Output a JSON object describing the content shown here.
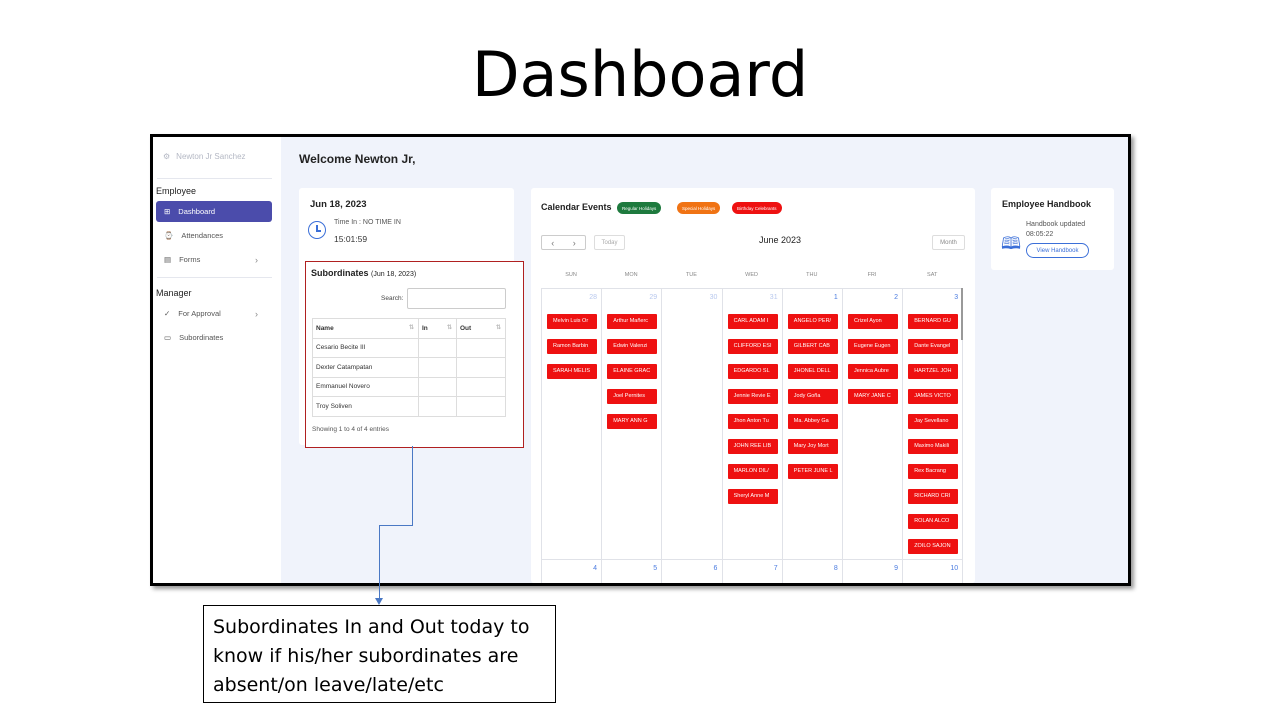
{
  "slide": {
    "title": "Dashboard",
    "callout": "Subordinates In and Out today to know if his/her subordinates are absent/on leave/late/etc"
  },
  "sidebar": {
    "user_name": "Newton Jr Sanchez",
    "sections": [
      {
        "label": "Employee"
      },
      {
        "label": "Manager"
      }
    ],
    "items": [
      {
        "label": "Dashboard",
        "icon": "grid-icon",
        "active": true
      },
      {
        "label": "Attendances",
        "icon": "watch-icon"
      },
      {
        "label": "Forms",
        "icon": "form-icon"
      },
      {
        "label": "For Approval",
        "icon": "check-icon"
      },
      {
        "label": "Subordinates",
        "icon": "monitor-icon"
      }
    ]
  },
  "header": {
    "welcome": "Welcome Newton Jr,"
  },
  "time_card": {
    "date": "Jun 18, 2023",
    "time_in_label": "Time In : NO TIME IN",
    "current_time": "15:01:59"
  },
  "subordinates": {
    "title": "Subordinates",
    "date": "(Jun 18, 2023)",
    "search_label": "Search:",
    "search_value": "",
    "columns": [
      "Name",
      "In",
      "Out"
    ],
    "rows": [
      {
        "name": "Cesario Becite III",
        "in": "",
        "out": ""
      },
      {
        "name": "Dexter Catampatan",
        "in": "",
        "out": ""
      },
      {
        "name": "Emmanuel Novero",
        "in": "",
        "out": ""
      },
      {
        "name": "Troy Soliven",
        "in": "",
        "out": ""
      }
    ],
    "footer": "Showing 1 to 4 of 4 entries"
  },
  "calendar": {
    "title": "Calendar Events",
    "legend": [
      {
        "label": "Regular Holidays",
        "color": "#1e7a3e"
      },
      {
        "label": "Special Holidays",
        "color": "#f07314"
      },
      {
        "label": "Birthday Celebrants",
        "color": "#ee1111"
      }
    ],
    "today_label": "Today",
    "month_label": "June 2023",
    "view_label": "Month",
    "days_of_week": [
      "SUN",
      "MON",
      "TUE",
      "WED",
      "THU",
      "FRI",
      "SAT"
    ],
    "week1_days": [
      "28",
      "29",
      "30",
      "31",
      "1",
      "2",
      "3"
    ],
    "week2_days": [
      "4",
      "5",
      "6",
      "7",
      "8",
      "9",
      "10"
    ],
    "events": [
      [
        "Melvin Luis Or",
        "Ramon Barbin",
        "SARAH MELIS"
      ],
      [
        "Arthur Mañerc",
        "Edwin Valenzi",
        "ELAINE GRAC",
        "Joel Pernites",
        "MARY ANN G"
      ],
      [],
      [
        "CARL ADAM I",
        "CLIFFORD ESI",
        "EDGARDO SL",
        "Jennie Revie E",
        "Jhon Anton Tu",
        "JOHN REE LIB",
        "MARLON DIL/",
        "Sheryl Anne M"
      ],
      [
        "ANGELO PER/",
        "GILBERT CAB",
        "JHONEL DELL",
        "Jody Goña",
        "Ma. Abbey Ga",
        "Mary Joy Mort",
        "PETER JUNE L"
      ],
      [
        "Crizel Ayon",
        "Eugene Eugen",
        "Jennica Aubre",
        "MARY JANE C"
      ],
      [
        "BERNARD GU",
        "Dante Evangel",
        "HARTZEL JOH",
        "JAMES VICTO",
        "Jay Sevellano",
        "Maximo Makili",
        "Rex Bacrang",
        "RICHARD CRI",
        "ROLAN ALCO",
        "ZOILO SAJON"
      ]
    ]
  },
  "handbook": {
    "title": "Employee Handbook",
    "updated_label": "Handbook updated",
    "updated_time": "08:05:22",
    "button_label": "View Handbook"
  }
}
